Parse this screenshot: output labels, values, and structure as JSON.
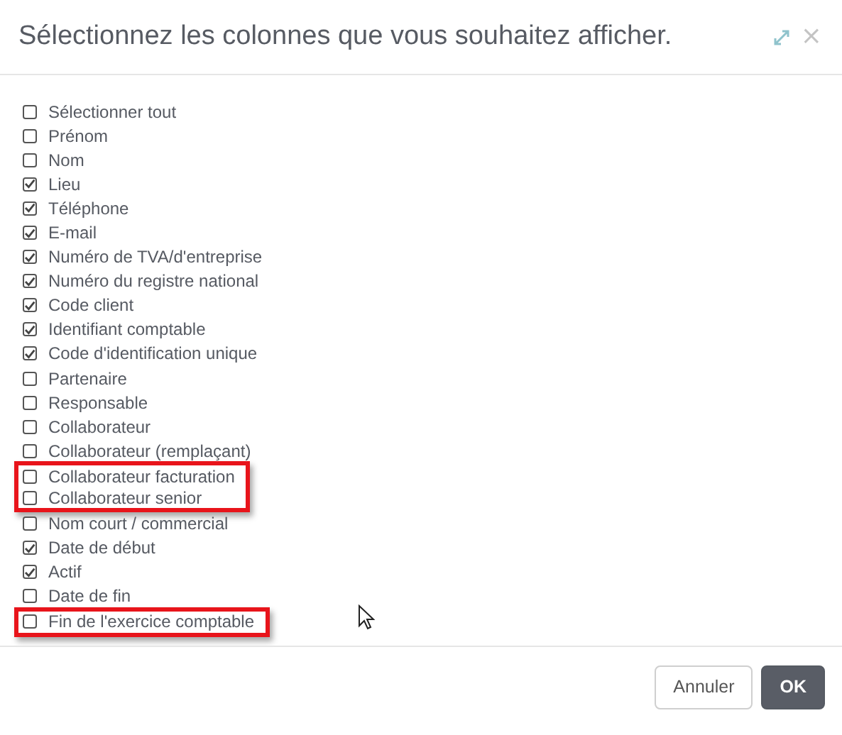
{
  "dialog": {
    "title": "Sélectionnez les colonnes que vous souhaitez afficher.",
    "close": "×",
    "columns": [
      {
        "label": "Sélectionner tout",
        "checked": false,
        "highlighted": false
      },
      {
        "label": "Prénom",
        "checked": false,
        "highlighted": false
      },
      {
        "label": "Nom",
        "checked": false,
        "highlighted": false
      },
      {
        "label": "Lieu",
        "checked": true,
        "highlighted": false
      },
      {
        "label": "Téléphone",
        "checked": true,
        "highlighted": false
      },
      {
        "label": "E-mail",
        "checked": true,
        "highlighted": false
      },
      {
        "label": "Numéro de TVA/d'entreprise",
        "checked": true,
        "highlighted": false
      },
      {
        "label": "Numéro du registre national",
        "checked": true,
        "highlighted": false
      },
      {
        "label": "Code client",
        "checked": true,
        "highlighted": false
      },
      {
        "label": "Identifiant comptable",
        "checked": true,
        "highlighted": false
      },
      {
        "label": "Code d'identification unique",
        "checked": true,
        "highlighted": false
      },
      {
        "label": "Partenaire",
        "checked": false,
        "highlighted": false
      },
      {
        "label": "Responsable",
        "checked": false,
        "highlighted": false
      },
      {
        "label": "Collaborateur",
        "checked": false,
        "highlighted": false
      },
      {
        "label": "Collaborateur (remplaçant)",
        "checked": false,
        "highlighted": false
      },
      {
        "label": "Collaborateur facturation",
        "checked": false,
        "highlighted": true
      },
      {
        "label": "Collaborateur senior",
        "checked": false,
        "highlighted": true
      },
      {
        "label": "Nom court / commercial",
        "checked": false,
        "highlighted": false
      },
      {
        "label": "Date de début",
        "checked": true,
        "highlighted": false
      },
      {
        "label": "Actif",
        "checked": true,
        "highlighted": false
      },
      {
        "label": "Date de fin",
        "checked": false,
        "highlighted": false
      },
      {
        "label": "Fin de l'exercice comptable",
        "checked": false,
        "highlighted": true
      }
    ],
    "buttons": [
      {
        "label": "Annuler",
        "kind": "secondary"
      },
      {
        "label": "OK",
        "kind": "primary"
      }
    ]
  }
}
